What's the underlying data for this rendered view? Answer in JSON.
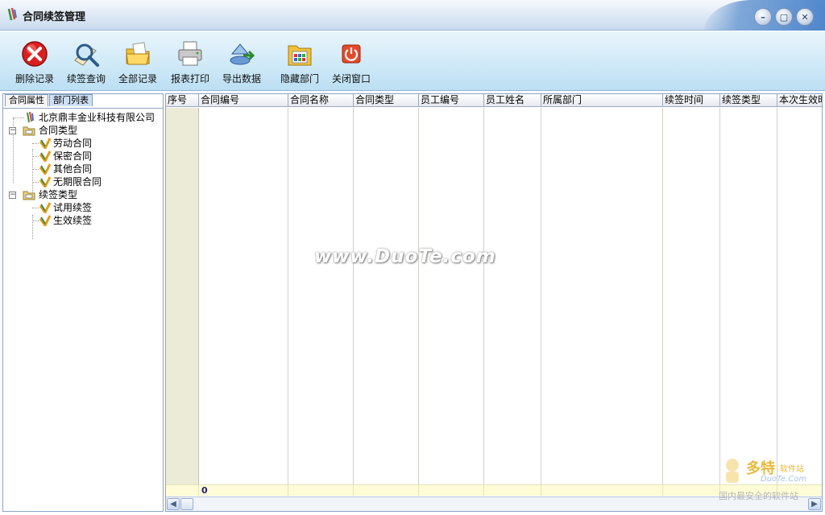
{
  "window": {
    "title": "合同续签管理",
    "minimize_glyph": "–",
    "maximize_glyph": "▢",
    "close_glyph": "✕"
  },
  "toolbar": {
    "items": [
      {
        "label": "删除记录",
        "icon": "delete-icon"
      },
      {
        "label": "续签查询",
        "icon": "magnifier-search-icon"
      },
      {
        "label": "全部记录",
        "icon": "folder-open-icon"
      },
      {
        "label": "报表打印",
        "icon": "printer-icon"
      },
      {
        "label": "导出数据",
        "icon": "export-data-icon"
      },
      {
        "label": "隐藏部门",
        "icon": "hide-department-icon"
      },
      {
        "label": "关闭窗口",
        "icon": "power-close-icon"
      }
    ]
  },
  "left_panel": {
    "tabs": [
      {
        "label": "合同属性",
        "active": false
      },
      {
        "label": "部门列表",
        "active": true
      }
    ],
    "tree": {
      "root": "北京鼎丰金业科技有限公司",
      "groups": [
        {
          "label": "合同类型",
          "expander": "−",
          "children": [
            "劳动合同",
            "保密合同",
            "其他合同",
            "无期限合同"
          ]
        },
        {
          "label": "续签类型",
          "expander": "−",
          "children": [
            "试用续签",
            "生效续签"
          ]
        }
      ]
    }
  },
  "grid": {
    "columns": [
      "序号",
      "合同编号",
      "合同名称",
      "合同类型",
      "员工编号",
      "员工姓名",
      "所属部门",
      "续签时间",
      "续签类型",
      "本次生效时间"
    ],
    "rows": [],
    "footer_count": "0"
  },
  "scrollbar": {
    "left_arrow": "◀",
    "right_arrow": "▶"
  },
  "watermark": {
    "center": "www.DuoTe.com",
    "corner_big": "多特",
    "corner_small": "软件站",
    "corner_url": "DuoTe.Com",
    "corner_tagline": "国内最安全的软件站"
  },
  "colors": {
    "accent": "#4f86cc",
    "toolbar_bg": "#d2ebf8",
    "first_col": "#ecebd8",
    "footer": "#fefcd6"
  }
}
